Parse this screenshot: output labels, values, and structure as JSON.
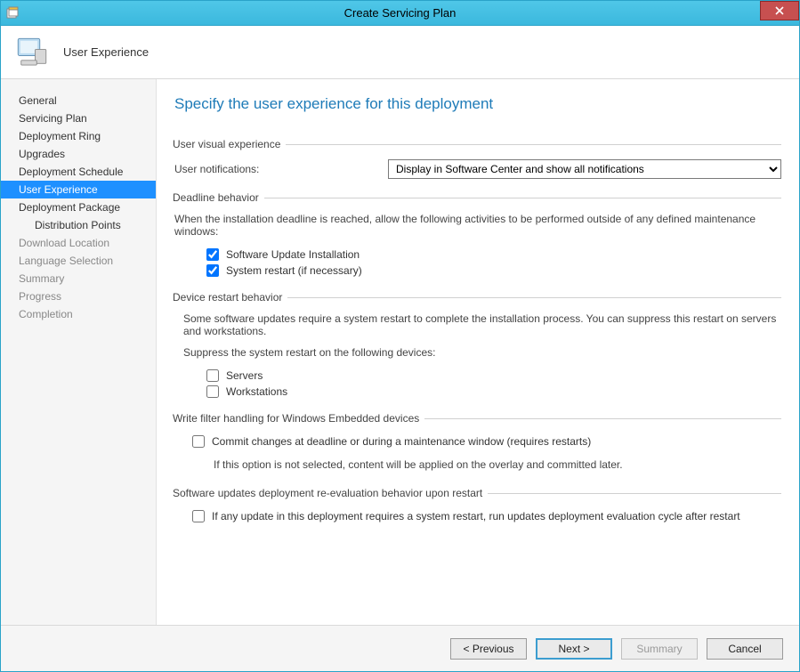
{
  "window": {
    "title": "Create Servicing Plan"
  },
  "header": {
    "page_label": "User Experience"
  },
  "sidebar": {
    "items": [
      {
        "label": "General",
        "selected": false,
        "disabled": false,
        "indent": false
      },
      {
        "label": "Servicing Plan",
        "selected": false,
        "disabled": false,
        "indent": false
      },
      {
        "label": "Deployment Ring",
        "selected": false,
        "disabled": false,
        "indent": false
      },
      {
        "label": "Upgrades",
        "selected": false,
        "disabled": false,
        "indent": false
      },
      {
        "label": "Deployment Schedule",
        "selected": false,
        "disabled": false,
        "indent": false
      },
      {
        "label": "User Experience",
        "selected": true,
        "disabled": false,
        "indent": false
      },
      {
        "label": "Deployment Package",
        "selected": false,
        "disabled": false,
        "indent": false
      },
      {
        "label": "Distribution Points",
        "selected": false,
        "disabled": false,
        "indent": true
      },
      {
        "label": "Download Location",
        "selected": false,
        "disabled": true,
        "indent": false
      },
      {
        "label": "Language Selection",
        "selected": false,
        "disabled": true,
        "indent": false
      },
      {
        "label": "Summary",
        "selected": false,
        "disabled": true,
        "indent": false
      },
      {
        "label": "Progress",
        "selected": false,
        "disabled": true,
        "indent": false
      },
      {
        "label": "Completion",
        "selected": false,
        "disabled": true,
        "indent": false
      }
    ]
  },
  "main": {
    "heading": "Specify the user experience for this deployment",
    "visual": {
      "legend": "User visual experience",
      "notif_label": "User notifications:",
      "notif_value": "Display in Software Center and show all notifications"
    },
    "deadline": {
      "legend": "Deadline behavior",
      "desc": "When the installation deadline is reached, allow the following activities to be performed outside of any defined maintenance windows:",
      "chk_install_label": "Software Update Installation",
      "chk_install_checked": true,
      "chk_restart_label": "System restart (if necessary)",
      "chk_restart_checked": true
    },
    "restart": {
      "legend": "Device restart behavior",
      "desc": "Some software updates require a system restart to complete the installation process. You can suppress this restart on servers and workstations.",
      "suppress_label": "Suppress the system restart on the following devices:",
      "chk_servers_label": "Servers",
      "chk_servers_checked": false,
      "chk_workstations_label": "Workstations",
      "chk_workstations_checked": false
    },
    "writefilter": {
      "legend": "Write filter handling for Windows Embedded devices",
      "chk_commit_label": "Commit changes at deadline or during a maintenance window (requires restarts)",
      "chk_commit_checked": false,
      "note": "If this option is not selected, content will be applied on the overlay and committed later."
    },
    "reeval": {
      "legend": "Software updates deployment re-evaluation behavior upon restart",
      "chk_label": "If any update in this deployment requires a system restart, run updates deployment evaluation cycle after restart",
      "chk_checked": false
    }
  },
  "footer": {
    "previous": "< Previous",
    "next": "Next >",
    "summary": "Summary",
    "cancel": "Cancel"
  }
}
